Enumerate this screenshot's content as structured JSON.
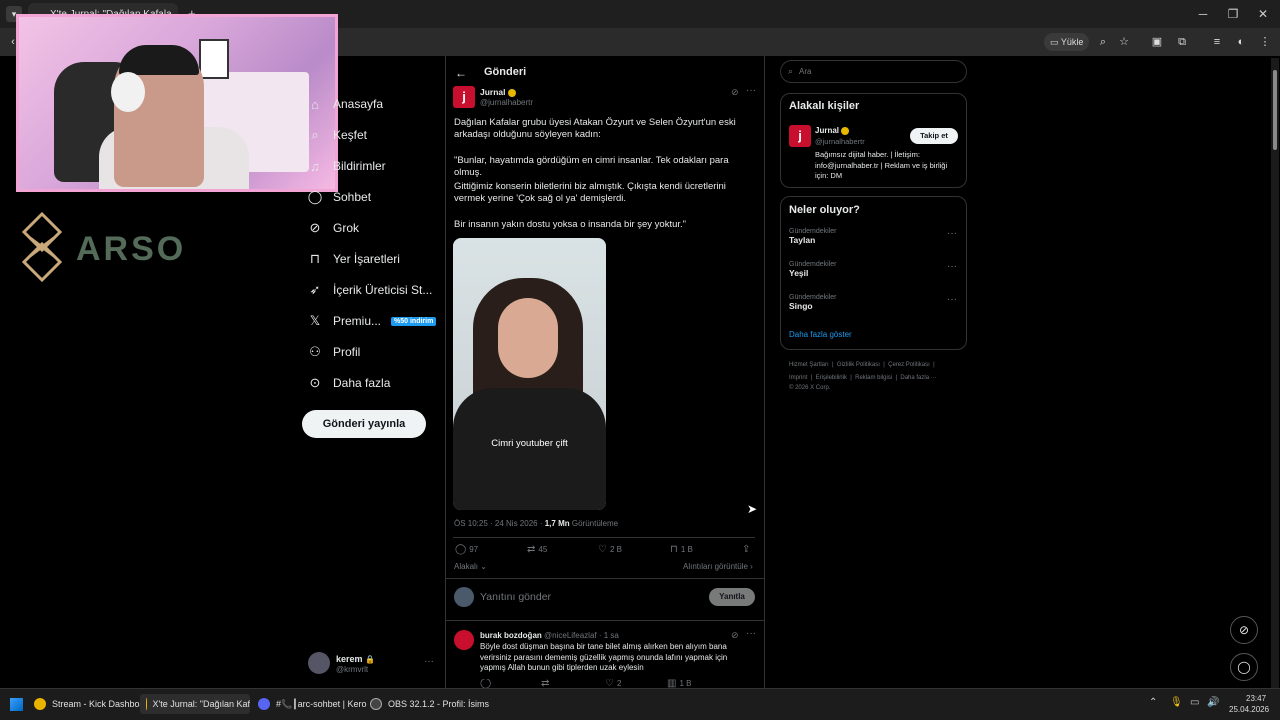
{
  "browser": {
    "active_tab_title": "X'te Jurnal: \"Dağılan Kafala",
    "toolbar_upload": "Yükle"
  },
  "overlay": {
    "brand": "ARSO"
  },
  "nav": {
    "items": [
      {
        "label": "Anasayfa",
        "icon": "home-icon"
      },
      {
        "label": "Keşfet",
        "icon": "search-icon"
      },
      {
        "label": "Bildirimler",
        "icon": "bell-icon"
      },
      {
        "label": "Sohbet",
        "icon": "chat-icon"
      },
      {
        "label": "Grok",
        "icon": "grok-icon"
      },
      {
        "label": "Yer İşaretleri",
        "icon": "bookmark-icon"
      },
      {
        "label": "İçerik Üreticisi St...",
        "icon": "rocket-icon"
      },
      {
        "label": "Premiu...",
        "icon": "x-icon",
        "badge": "%50 indirim"
      },
      {
        "label": "Profil",
        "icon": "person-icon"
      },
      {
        "label": "Daha fazla",
        "icon": "more-circle-icon"
      }
    ],
    "post_button": "Gönderi yayınla",
    "account": {
      "name": "kerem",
      "handle": "@krmvrlt"
    }
  },
  "main": {
    "header_title": "Gönderi",
    "tweet": {
      "author": "Jurnal",
      "handle": "@jurnalhabertr",
      "avatar_letter": "j",
      "p1": "Dağılan Kafalar grubu üyesi Atakan Özyurt ve Selen Özyurt'un eski arkadaşı olduğunu söyleyen kadın:",
      "p2": "\"Bunlar, hayatımda gördüğüm en cimri insanlar. Tek odakları para olmuş.",
      "p3": "Gittiğimiz konserin biletlerini biz almıştık. Çıkışta kendi ücretlerini vermek yerine 'Çok sağ ol ya' demişlerdi.",
      "p4": "Bir insanın yakın dostu yoksa o insanda bir şey yoktur.\"",
      "video_caption": "Cimri youtuber çift",
      "time": "ÖS 10:25 · 24 Nis 2026 ·",
      "views": "1,7 Mn",
      "views_label": "Görüntüleme",
      "replies": "97",
      "reposts": "45",
      "likes": "2 B",
      "bookmarks": "1 B",
      "relevant": "Alakalı",
      "quotes": "Alıntıları görüntüle"
    },
    "reply_box": {
      "placeholder": "Yanıtını gönder",
      "button": "Yanıtla"
    },
    "reply": {
      "author": "burak bozdoğan",
      "handle": "@niceLifeazlaf",
      "time": "· 1 sa",
      "text": "Böyle dost düşman başına bir tane bilet almış alırken ben alıyım bana verirsiniz parasını dememiş güzellik yapmış onunda lafını yapmak için yapmış Allah bunun gibi tiplerden uzak eylesin",
      "likes": "2",
      "views": "1 B"
    }
  },
  "right": {
    "search_placeholder": "Ara",
    "people_title": "Alakalı kişiler",
    "person": {
      "name": "Jurnal",
      "handle": "@jurnalhabertr",
      "follow": "Takip et",
      "bio": "Bağımsız dijital haber. | İletişim: info@jurnalhaber.tr | Reklam ve iş birliği için: DM"
    },
    "trends_title": "Neler oluyor?",
    "trends": [
      {
        "category": "Gündemdekiler",
        "name": "Taylan"
      },
      {
        "category": "Gündemdekiler",
        "name": "Yeşil"
      },
      {
        "category": "Gündemdekiler",
        "name": "Singo"
      }
    ],
    "show_more": "Daha fazla göster",
    "footer_line1": "Hizmet Şartları  |  Gizlilik Politikası  |  Çerez Politikası  |",
    "footer_line2": "Imprint  |  Erişilebilirlik  |  Reklam bilgisi  |  Daha fazla ···",
    "footer_line3": "© 2026 X Corp."
  },
  "taskbar": {
    "items": [
      "Stream - Kick Dashboar",
      "X'te Jurnal: \"Dağılan Kaf",
      "#📞┃arc-sohbet | Kero",
      "OBS 32.1.2 - Profil: İsims"
    ],
    "time": "23:47",
    "date": "25.04.2026"
  },
  "colors": {
    "accent": "#1d9bf0",
    "bg": "#000000",
    "border": "#2f3336",
    "muted": "#71767b",
    "brand_red": "#c8102e"
  }
}
